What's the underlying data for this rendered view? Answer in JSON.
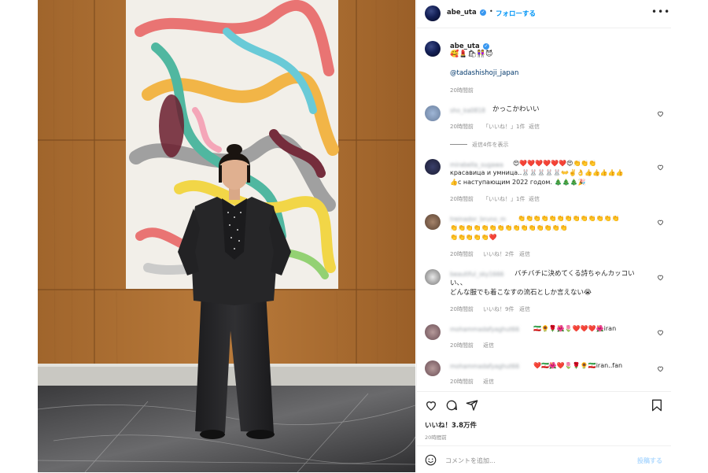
{
  "post": {
    "author": "abe_uta",
    "follow_label": "フォローする",
    "more_label": "•••",
    "caption_emoji": "🥰💄🛍👭😈",
    "caption_mention": "@tadashishoji_japan",
    "caption_time": "20時間前"
  },
  "comments": [
    {
      "user": "sho_ka0818",
      "lines": [
        "かっこかわいい"
      ],
      "time": "20時間前",
      "likes": "「いいね！」1件",
      "reply": "返信",
      "view_replies": "返信4件を表示"
    },
    {
      "user": "mirabella_sugawa",
      "lines": [
        "😍❤️❤️❤️❤️❤️❤️😍👏👏👏",
        "красавица и умница..🐰🐰🐰🐰🐰👐✌️👌👍👍👍👍👍",
        "👍с наступающим 2022 годом. 🎄🎄🎄🎉"
      ],
      "time": "20時間前",
      "likes": "「いいね！」1件",
      "reply": "返信"
    },
    {
      "user": "treinador_bruno_m",
      "lines": [
        "👏👏👏👏👏👏👏👏👏👏👏👏👏",
        "👏👏👏👏👏👏👏👏👏👏👏👏👏👏👏",
        "👏👏👏👏👏❤️"
      ],
      "time": "20時間前",
      "likes": "いいね！2件",
      "reply": "返信"
    },
    {
      "user": "beautiful_sky1666",
      "lines": [
        "バチバチに決めてくる詩ちゃんカッコい",
        "い、、",
        "どんな服でも着こなすの流石としか言えない😭"
      ],
      "time": "20時間前",
      "likes": "いいね！9件",
      "reply": "返信"
    },
    {
      "user": "mohammadafyaghut66",
      "lines": [
        "🇮🇷🌻🌹🌺🌷❤️❤️❤️🌺iran"
      ],
      "time": "20時間前",
      "reply": "返信"
    },
    {
      "user": "mohammadafyaghut66",
      "lines": [
        "❤️🇮🇷🌺❤️🌷🌹🌻🇮🇷iran..fan"
      ],
      "time": "20時間前",
      "reply": "返信"
    }
  ],
  "stats": {
    "likes": "いいね！3.8万件",
    "time": "20時間前"
  },
  "composer": {
    "placeholder": "コメントを追加...",
    "post_label": "投稿する"
  },
  "colors": {
    "accent": "#0095f6",
    "muted": "#8e8e8e",
    "like_red": "#ed4956"
  },
  "icons": [
    "heart-icon",
    "comment-icon",
    "share-icon",
    "bookmark-icon",
    "emoji-icon",
    "verified-icon"
  ]
}
